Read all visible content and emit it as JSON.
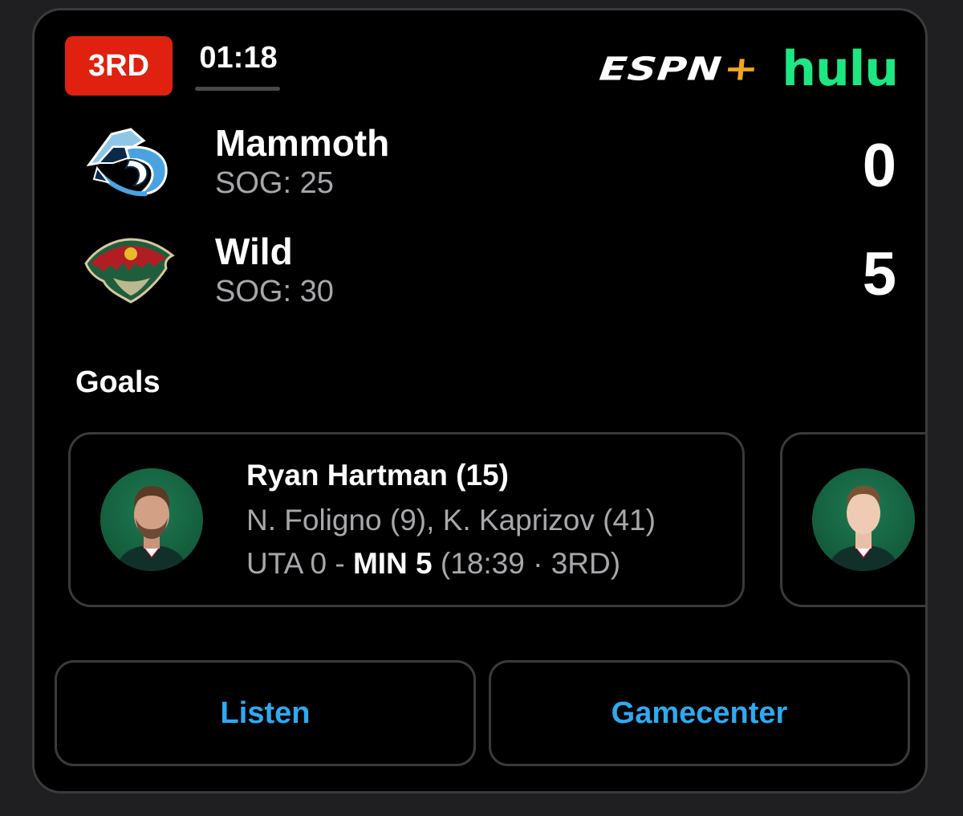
{
  "game": {
    "period": "3RD",
    "clock": "01:18",
    "broadcasters": {
      "espn": "ESPN",
      "espn_plus": "+",
      "hulu": "hulu"
    }
  },
  "teams": [
    {
      "name": "Mammoth",
      "sog": "SOG: 25",
      "score": "0",
      "logo_icon": "mammoth-logo"
    },
    {
      "name": "Wild",
      "sog": "SOG: 30",
      "score": "5",
      "logo_icon": "wild-logo"
    }
  ],
  "goals": {
    "heading": "Goals",
    "items": [
      {
        "scorer": "Ryan Hartman (15)",
        "assists": "N. Foligno (9), K. Kaprizov (41)",
        "away_part": "UTA 0 - ",
        "home_part": "MIN 5",
        "time_part": " (18:39 · 3RD)"
      }
    ]
  },
  "buttons": {
    "listen": "Listen",
    "gamecenter": "Gamecenter"
  },
  "colors": {
    "period_badge": "#e0210f",
    "espn_plus": "#f2a51c",
    "hulu": "#1ce783",
    "link": "#2eaaf0",
    "muted_text": "#a8a8ac",
    "border": "#3a3a3c"
  }
}
